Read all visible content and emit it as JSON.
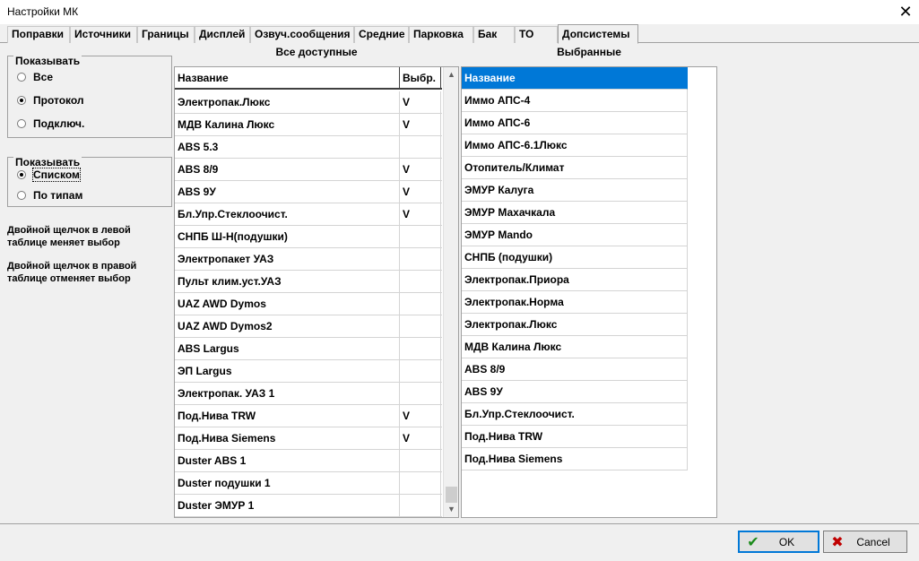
{
  "window": {
    "title": "Настройки МК",
    "close_icon": "close-icon"
  },
  "tabs": [
    "Поправки",
    "Источники",
    "Границы",
    "Дисплей",
    "Озвуч.сообщения",
    "Средние",
    "Парковка",
    "Бак",
    "ТО",
    "Допсистемы"
  ],
  "active_tab": "Допсистемы",
  "show_group1": {
    "legend": "Показывать",
    "options": [
      "Все",
      "Протокол",
      "Подключ."
    ],
    "selected": "Протокол"
  },
  "show_group2": {
    "legend": "Показывать",
    "options": [
      "Списком",
      "По типам"
    ],
    "selected": "Списком"
  },
  "notes": {
    "left_line1": "Двойной щелчок в левой",
    "left_line2": "таблице меняет выбор",
    "right_line1": "Двойной щелчок в правой",
    "right_line2": "таблице отменяет выбор"
  },
  "available": {
    "title": "Все доступные",
    "columns": [
      "Название",
      "Выбр."
    ],
    "rows": [
      [
        "Электропак.Люкс",
        "V"
      ],
      [
        "МДВ Калина Люкс",
        "V"
      ],
      [
        "ABS 5.3",
        ""
      ],
      [
        "ABS 8/9",
        "V"
      ],
      [
        "ABS 9У",
        "V"
      ],
      [
        "Бл.Упр.Стеклоочист.",
        "V"
      ],
      [
        "СНПБ Ш-Н(подушки)",
        ""
      ],
      [
        "Электропакет УАЗ",
        ""
      ],
      [
        "Пульт клим.уст.УАЗ",
        ""
      ],
      [
        "UAZ AWD Dymos",
        ""
      ],
      [
        "UAZ AWD Dymos2",
        ""
      ],
      [
        "ABS Largus",
        ""
      ],
      [
        "ЭП Largus",
        ""
      ],
      [
        "Электропак. УАЗ 1",
        ""
      ],
      [
        "Под.Нива TRW",
        "V"
      ],
      [
        "Под.Нива Siemens",
        "V"
      ],
      [
        "Duster ABS 1",
        ""
      ],
      [
        "Duster подушки 1",
        ""
      ],
      [
        "Duster ЭМУР 1",
        ""
      ]
    ]
  },
  "selected": {
    "title": "Выбранные",
    "header": "Название",
    "rows": [
      "Иммо АПС-4",
      "Иммо АПС-6",
      "Иммо АПС-6.1Люкс",
      "Отопитель/Климат",
      "ЭМУР Калуга",
      "ЭМУР Махачкала",
      "ЭМУР Mando",
      "СНПБ (подушки)",
      "Электропак.Приора",
      "Электропак.Норма",
      "Электропак.Люкс",
      "МДВ Калина Люкс",
      "ABS 8/9",
      "ABS 9У",
      "Бл.Упр.Стеклоочист.",
      "Под.Нива TRW",
      "Под.Нива Siemens"
    ]
  },
  "buttons": {
    "ok": "OK",
    "cancel": "Cancel"
  },
  "colors": {
    "accent": "#0078d7",
    "ok_icon": "#1a8a1a",
    "cancel_icon": "#c00000"
  }
}
